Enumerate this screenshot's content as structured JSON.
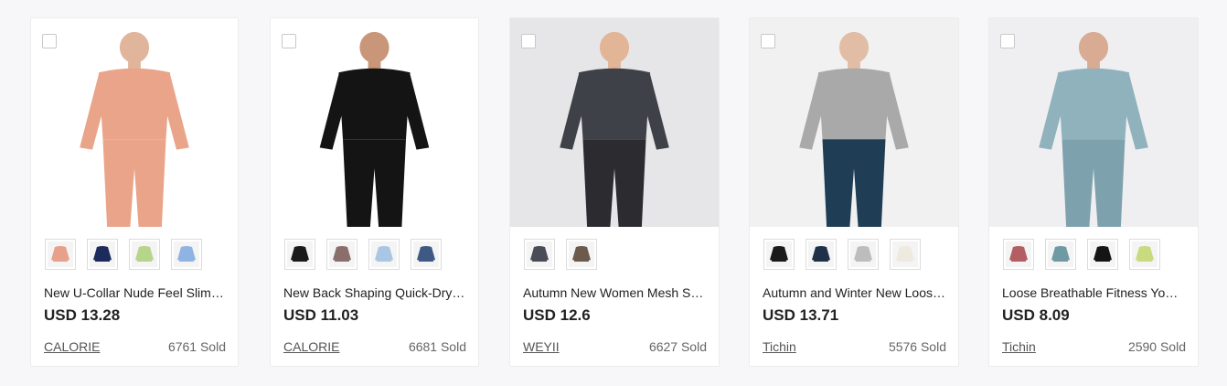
{
  "products": [
    {
      "title": "New U-Collar Nude Feel Slim Fi...",
      "price": "USD 13.28",
      "store": "CALORIE",
      "sold": "6761 Sold",
      "image": {
        "bg": "#ffffff",
        "skin": "#e0b59c",
        "top": "#e9a48a",
        "bottom": "#e9a48a"
      },
      "swatches": [
        "#e7a089",
        "#1c2a5c",
        "#b6d48a",
        "#8fb4e3"
      ]
    },
    {
      "title": "New Back Shaping Quick-Dryin...",
      "price": "USD 11.03",
      "store": "CALORIE",
      "sold": "6681 Sold",
      "image": {
        "bg": "#ffffff",
        "skin": "#c9967a",
        "top": "#141414",
        "bottom": "#141414"
      },
      "swatches": [
        "#1a1a1a",
        "#8a6e6c",
        "#a9c6e2",
        "#3e5a84"
      ]
    },
    {
      "title": "Autumn New Women Mesh Stit...",
      "price": "USD 12.6",
      "store": "WEYII",
      "sold": "6627 Sold",
      "image": {
        "bg": "#e6e6e8",
        "skin": "#e2b596",
        "top": "#3f4148",
        "bottom": "#2b2b30"
      },
      "swatches": [
        "#4a4d57",
        "#6c5a4c"
      ]
    },
    {
      "title": "Autumn and Winter New Loose...",
      "price": "USD 13.71",
      "store": "Tichin",
      "sold": "5576 Sold",
      "image": {
        "bg": "#f1f1f1",
        "skin": "#e2bda6",
        "top": "#a9a9a9",
        "bottom": "#1f3d55"
      },
      "swatches": [
        "#1a1a1a",
        "#1f3148",
        "#bdbdbd",
        "#efeadf"
      ]
    },
    {
      "title": "Loose Breathable Fitness Yoga ...",
      "price": "USD 8.09",
      "store": "Tichin",
      "sold": "2590 Sold",
      "image": {
        "bg": "#efeff1",
        "skin": "#d9ab93",
        "top": "#8fb2bd",
        "bottom": "#7ea2ad"
      },
      "swatches": [
        "#b35e63",
        "#6f9aa3",
        "#151515",
        "#c9da7f"
      ]
    }
  ]
}
